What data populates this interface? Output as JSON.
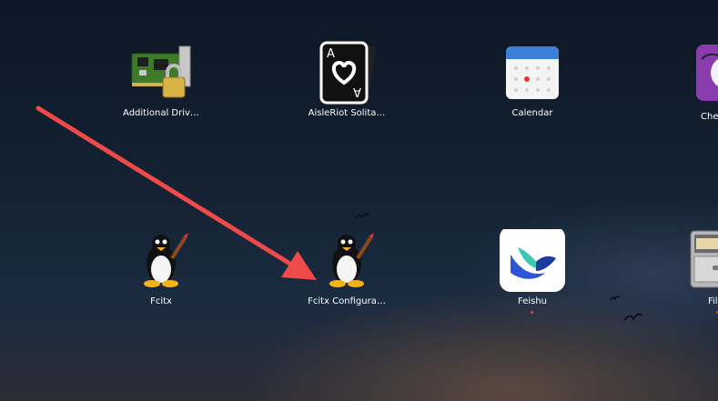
{
  "apps": [
    {
      "label": "Additional Driv…",
      "icon": "hardware-card-lock-icon",
      "running": false
    },
    {
      "label": "AisleRiot Solita…",
      "icon": "playing-card-icon",
      "running": false
    },
    {
      "label": "Calendar",
      "icon": "calendar-icon",
      "running": false
    },
    {
      "label": "Che",
      "icon": "cheese-webcam-icon",
      "running": false
    },
    {
      "label": "Fcitx",
      "icon": "tux-penguin-icon",
      "running": false
    },
    {
      "label": "Fcitx Configura…",
      "icon": "tux-penguin-icon",
      "running": false
    },
    {
      "label": "Feishu",
      "icon": "feishu-bird-icon",
      "running": true
    },
    {
      "label": "Fil",
      "icon": "file-cabinet-icon",
      "running": true
    }
  ],
  "annotation": {
    "type": "arrow",
    "color": "#ef4a4a"
  }
}
